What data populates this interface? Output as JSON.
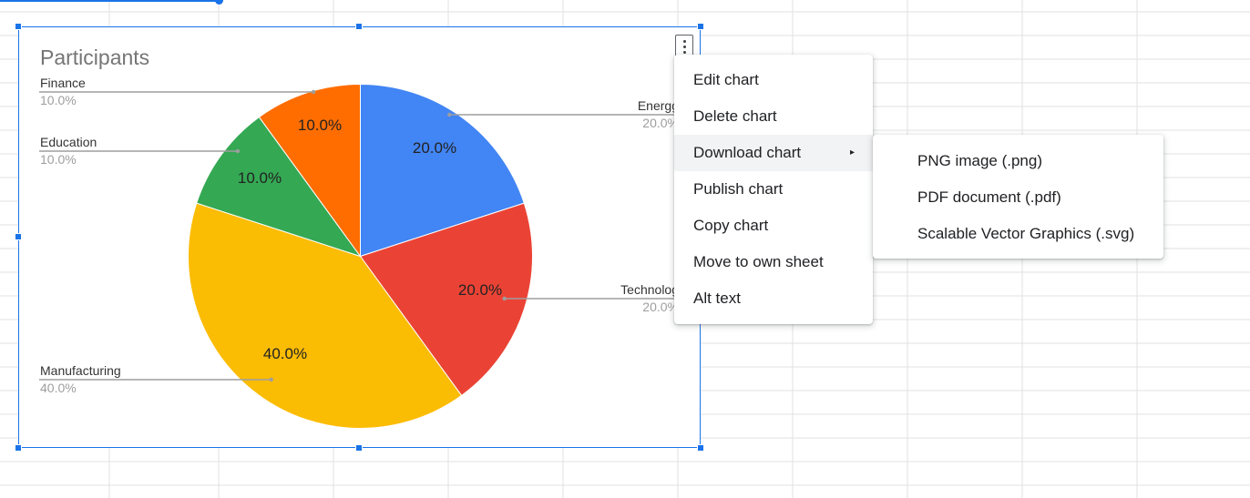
{
  "chart_data": {
    "type": "pie",
    "title": "Participants",
    "slices": [
      {
        "label": "Energy",
        "value": 20,
        "pct_label": "20.0%",
        "legend_pct": "20.0%",
        "color": "#4285f4",
        "legend_text": "Energg"
      },
      {
        "label": "Technology",
        "value": 20,
        "pct_label": "20.0%",
        "legend_pct": "20.0%",
        "color": "#ea4335",
        "legend_text": "Technolog"
      },
      {
        "label": "Manufacturing",
        "value": 40,
        "pct_label": "40.0%",
        "legend_pct": "40.0%",
        "color": "#fbbc04",
        "legend_text": "Manufacturing"
      },
      {
        "label": "Education",
        "value": 10,
        "pct_label": "10.0%",
        "legend_pct": "10.0%",
        "color": "#34a853",
        "legend_text": "Education"
      },
      {
        "label": "Finance",
        "value": 10,
        "pct_label": "10.0%",
        "legend_pct": "10.0%",
        "color": "#ff6d01",
        "legend_text": "Finance"
      }
    ]
  },
  "context_menu": {
    "items": [
      {
        "label": "Edit chart"
      },
      {
        "label": "Delete chart"
      },
      {
        "label": "Download chart",
        "has_submenu": true,
        "active": true
      },
      {
        "label": "Publish chart"
      },
      {
        "label": "Copy chart"
      },
      {
        "label": "Move to own sheet"
      },
      {
        "label": "Alt text"
      }
    ],
    "submenu_arrow": "▸"
  },
  "download_submenu": {
    "items": [
      {
        "label": "PNG image (.png)"
      },
      {
        "label": "PDF document (.pdf)"
      },
      {
        "label": "Scalable Vector Graphics (.svg)"
      }
    ]
  },
  "icons": {
    "kebab": "more-vert-icon",
    "submenu": "play-arrow-icon"
  },
  "colors": {
    "selection": "#1a73e8",
    "menu_hover": "#f1f3f4",
    "gridline": "#e2e2e2"
  }
}
